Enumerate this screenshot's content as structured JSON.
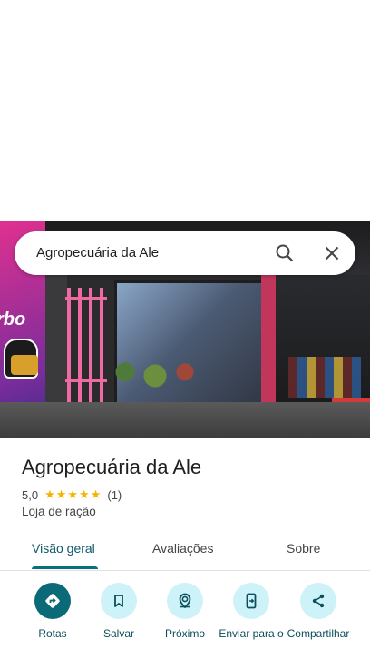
{
  "search": {
    "query": "Agropecuária da Ale"
  },
  "place": {
    "name": "Agropecuária da Ale",
    "rating": "5,0",
    "stars": "★★★★★",
    "review_count": "(1)",
    "category": "Loja de ração",
    "photo_banner_text": "rbo"
  },
  "tabs": [
    {
      "label": "Visão geral",
      "active": true
    },
    {
      "label": "Avaliações",
      "active": false
    },
    {
      "label": "Sobre",
      "active": false
    }
  ],
  "actions": [
    {
      "label": "Rotas",
      "icon": "directions-icon"
    },
    {
      "label": "Salvar",
      "icon": "bookmark-icon"
    },
    {
      "label": "Próximo",
      "icon": "nearby-icon"
    },
    {
      "label": "Enviar para o",
      "icon": "send-to-phone-icon"
    },
    {
      "label": "Compartilhar",
      "icon": "share-icon"
    }
  ],
  "colors": {
    "accent": "#0b6a78",
    "action_bg": "#cdf2f8",
    "star": "#f4b400"
  }
}
